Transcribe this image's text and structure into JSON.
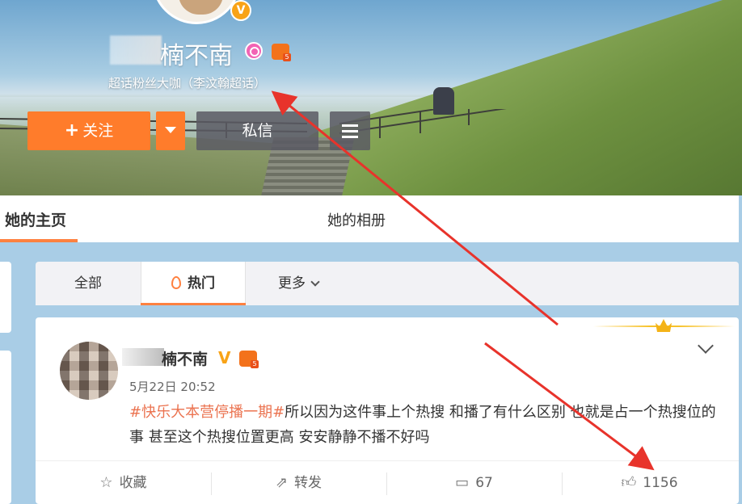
{
  "profile": {
    "name_visible": "楠不南",
    "verified_badge": "V",
    "super_fan_text": "超话粉丝大咖（李汶翰超话）",
    "follow_button": "关注",
    "follow_plus": "+",
    "message_button": "私信"
  },
  "nav": {
    "home_tab": "她的主页",
    "album_tab": "她的相册"
  },
  "filter": {
    "all": "全部",
    "hot": "热门",
    "more": "更多"
  },
  "post": {
    "author": "楠不南",
    "verified": "V",
    "time": "5月22日 20:52",
    "hashtag": "#快乐大本营停播一期#",
    "text": "所以因为这件事上个热搜 和播了有什么区别 也就是占一个热搜位的事 甚至这个热搜位置更高 安安静静不播不好吗",
    "actions": {
      "favorite": "收藏",
      "repost": "转发",
      "comments": "67",
      "likes": "1156"
    }
  },
  "colors": {
    "accent_orange": "#ff7c2b",
    "tab_underline": "#ff8140",
    "hashtag": "#eb7350",
    "annotation_red": "#e8332b"
  },
  "icons": [
    "v-badge-icon",
    "super-topic-icon",
    "fan-level-icon",
    "menu-icon",
    "flame-icon",
    "chevron-down-icon",
    "star-icon",
    "repost-icon",
    "comment-icon",
    "like-icon",
    "crown-icon"
  ]
}
